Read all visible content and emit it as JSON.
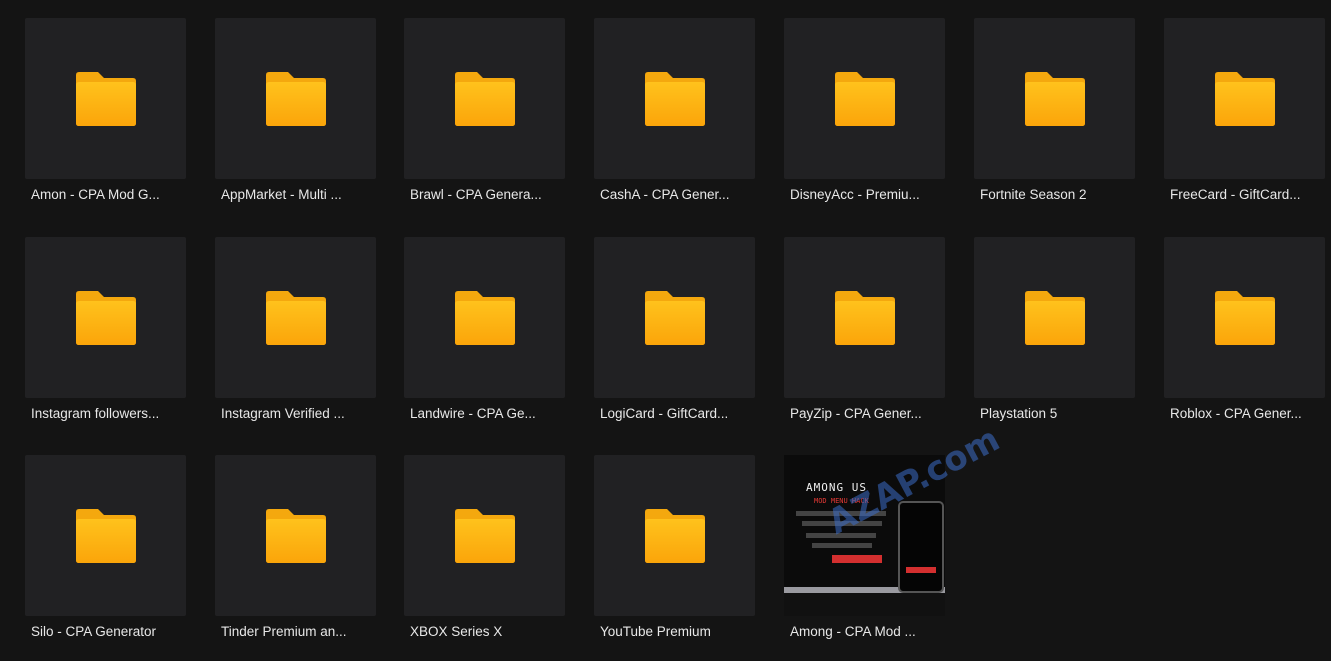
{
  "colors": {
    "background": "#141414",
    "tile": "#212123",
    "folder_top": "#FFC21C",
    "folder_bottom": "#FBA50A",
    "label": "#e8e8e8"
  },
  "items": [
    {
      "label": "Amon - CPA Mod G...",
      "icon": "folder-icon"
    },
    {
      "label": "AppMarket - Multi ...",
      "icon": "folder-icon"
    },
    {
      "label": "Brawl - CPA Genera...",
      "icon": "folder-icon"
    },
    {
      "label": "CashA - CPA Gener...",
      "icon": "folder-icon"
    },
    {
      "label": "DisneyAcc - Premiu...",
      "icon": "folder-icon"
    },
    {
      "label": "Fortnite Season 2",
      "icon": "folder-icon"
    },
    {
      "label": "FreeCard - GiftCard...",
      "icon": "folder-icon"
    },
    {
      "label": "Instagram followers...",
      "icon": "folder-icon"
    },
    {
      "label": "Instagram Verified ...",
      "icon": "folder-icon"
    },
    {
      "label": "Landwire - CPA Ge...",
      "icon": "folder-icon"
    },
    {
      "label": "LogiCard - GiftCard...",
      "icon": "folder-icon"
    },
    {
      "label": "PayZip - CPA Gener...",
      "icon": "folder-icon"
    },
    {
      "label": "Playstation 5",
      "icon": "folder-icon"
    },
    {
      "label": "Roblox - CPA Gener...",
      "icon": "folder-icon"
    },
    {
      "label": "Silo - CPA Generator",
      "icon": "folder-icon"
    },
    {
      "label": "Tinder Premium an...",
      "icon": "folder-icon"
    },
    {
      "label": "XBOX Series X",
      "icon": "folder-icon"
    },
    {
      "label": "YouTube Premium",
      "icon": "folder-icon"
    },
    {
      "label": "Among - CPA Mod ...",
      "icon": "image-thumbnail"
    }
  ],
  "preview": {
    "title": "AMONG US",
    "subtitle": "MOD MENU HACK",
    "watermark": "AZAP.com"
  }
}
